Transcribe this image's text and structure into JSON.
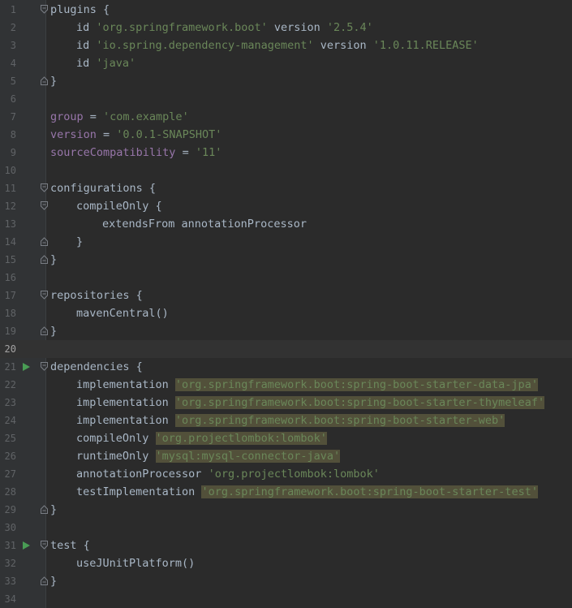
{
  "lines": [
    {
      "n": "1",
      "indent": 0,
      "parts": [
        {
          "t": "plugins {",
          "c": "kw"
        }
      ],
      "fold": "open"
    },
    {
      "n": "2",
      "indent": 1,
      "parts": [
        {
          "t": "id ",
          "c": "kw"
        },
        {
          "t": "'org.springframework.boot'",
          "c": "str"
        },
        {
          "t": " version ",
          "c": "kw"
        },
        {
          "t": "'2.5.4'",
          "c": "str"
        }
      ]
    },
    {
      "n": "3",
      "indent": 1,
      "parts": [
        {
          "t": "id ",
          "c": "kw"
        },
        {
          "t": "'io.spring.dependency-management'",
          "c": "str"
        },
        {
          "t": " version ",
          "c": "kw"
        },
        {
          "t": "'1.0.11.RELEASE'",
          "c": "str"
        }
      ]
    },
    {
      "n": "4",
      "indent": 1,
      "parts": [
        {
          "t": "id ",
          "c": "kw"
        },
        {
          "t": "'java'",
          "c": "str"
        }
      ]
    },
    {
      "n": "5",
      "indent": 0,
      "parts": [
        {
          "t": "}",
          "c": "kw"
        }
      ],
      "fold": "close"
    },
    {
      "n": "6",
      "indent": 0,
      "parts": []
    },
    {
      "n": "7",
      "indent": 0,
      "parts": [
        {
          "t": "group",
          "c": "prop"
        },
        {
          "t": " = ",
          "c": "kw"
        },
        {
          "t": "'com.example'",
          "c": "str"
        }
      ]
    },
    {
      "n": "8",
      "indent": 0,
      "parts": [
        {
          "t": "version",
          "c": "prop"
        },
        {
          "t": " = ",
          "c": "kw"
        },
        {
          "t": "'0.0.1-SNAPSHOT'",
          "c": "str"
        }
      ]
    },
    {
      "n": "9",
      "indent": 0,
      "parts": [
        {
          "t": "sourceCompatibility",
          "c": "prop"
        },
        {
          "t": " = ",
          "c": "kw"
        },
        {
          "t": "'11'",
          "c": "str"
        }
      ]
    },
    {
      "n": "10",
      "indent": 0,
      "parts": []
    },
    {
      "n": "11",
      "indent": 0,
      "parts": [
        {
          "t": "configurations {",
          "c": "kw"
        }
      ],
      "fold": "open"
    },
    {
      "n": "12",
      "indent": 1,
      "parts": [
        {
          "t": "compileOnly {",
          "c": "kw"
        }
      ],
      "fold": "open"
    },
    {
      "n": "13",
      "indent": 2,
      "parts": [
        {
          "t": "extendsFrom annotationProcessor",
          "c": "kw"
        }
      ]
    },
    {
      "n": "14",
      "indent": 1,
      "parts": [
        {
          "t": "}",
          "c": "kw"
        }
      ],
      "fold": "close"
    },
    {
      "n": "15",
      "indent": 0,
      "parts": [
        {
          "t": "}",
          "c": "kw"
        }
      ],
      "fold": "close"
    },
    {
      "n": "16",
      "indent": 0,
      "parts": []
    },
    {
      "n": "17",
      "indent": 0,
      "parts": [
        {
          "t": "repositories {",
          "c": "kw"
        }
      ],
      "fold": "open"
    },
    {
      "n": "18",
      "indent": 1,
      "parts": [
        {
          "t": "mavenCentral()",
          "c": "kw"
        }
      ]
    },
    {
      "n": "19",
      "indent": 0,
      "parts": [
        {
          "t": "}",
          "c": "kw"
        }
      ],
      "fold": "close"
    },
    {
      "n": "20",
      "indent": 0,
      "parts": [],
      "current": true
    },
    {
      "n": "21",
      "indent": 0,
      "parts": [
        {
          "t": "dependencies {",
          "c": "kw"
        }
      ],
      "fold": "open",
      "run": true
    },
    {
      "n": "22",
      "indent": 1,
      "parts": [
        {
          "t": "implementation ",
          "c": "kw"
        },
        {
          "t": "'org.springframework.boot:spring-boot-starter-data-jpa'",
          "c": "str hl"
        }
      ]
    },
    {
      "n": "23",
      "indent": 1,
      "parts": [
        {
          "t": "implementation ",
          "c": "kw"
        },
        {
          "t": "'org.springframework.boot:spring-boot-starter-thymeleaf'",
          "c": "str hl"
        }
      ]
    },
    {
      "n": "24",
      "indent": 1,
      "parts": [
        {
          "t": "implementation ",
          "c": "kw"
        },
        {
          "t": "'org.springframework.boot:spring-boot-starter-web'",
          "c": "str hl"
        }
      ]
    },
    {
      "n": "25",
      "indent": 1,
      "parts": [
        {
          "t": "compileOnly ",
          "c": "kw"
        },
        {
          "t": "'org.projectlombok:lombok'",
          "c": "str hl"
        }
      ]
    },
    {
      "n": "26",
      "indent": 1,
      "parts": [
        {
          "t": "runtimeOnly ",
          "c": "kw"
        },
        {
          "t": "'mysql:mysql-connector-java'",
          "c": "str hl"
        }
      ]
    },
    {
      "n": "27",
      "indent": 1,
      "parts": [
        {
          "t": "annotationProcessor ",
          "c": "kw"
        },
        {
          "t": "'org.projectlombok:lombok'",
          "c": "str"
        }
      ]
    },
    {
      "n": "28",
      "indent": 1,
      "parts": [
        {
          "t": "testImplementation ",
          "c": "kw"
        },
        {
          "t": "'org.springframework.boot:spring-boot-starter-test'",
          "c": "str hl"
        }
      ]
    },
    {
      "n": "29",
      "indent": 0,
      "parts": [
        {
          "t": "}",
          "c": "kw"
        }
      ],
      "fold": "close"
    },
    {
      "n": "30",
      "indent": 0,
      "parts": []
    },
    {
      "n": "31",
      "indent": 0,
      "parts": [
        {
          "t": "test {",
          "c": "kw"
        }
      ],
      "fold": "open",
      "run": true
    },
    {
      "n": "32",
      "indent": 1,
      "parts": [
        {
          "t": "useJUnitPlatform()",
          "c": "kw"
        }
      ]
    },
    {
      "n": "33",
      "indent": 0,
      "parts": [
        {
          "t": "}",
          "c": "kw"
        }
      ],
      "fold": "close"
    },
    {
      "n": "34",
      "indent": 0,
      "parts": []
    }
  ],
  "colors": {
    "background": "#2b2b2b",
    "gutter": "#313335",
    "line_number": "#606366",
    "text": "#a9b7c6",
    "string": "#6a8759",
    "property": "#9876aa",
    "highlight": "#52503a",
    "run_icon": "#499c54",
    "current_line": "#323232"
  }
}
